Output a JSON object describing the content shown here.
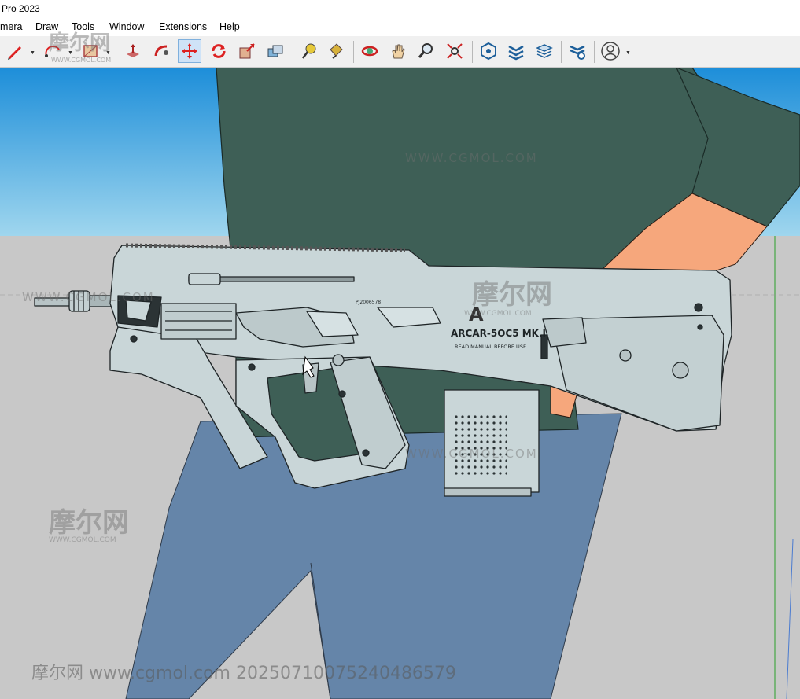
{
  "window": {
    "title": "Pro 2023"
  },
  "menu": {
    "items": [
      "mera",
      "Draw",
      "Tools",
      "Window",
      "Extensions",
      "Help"
    ]
  },
  "toolbar": {
    "tools": [
      {
        "name": "pencil-tool",
        "icon": "pencil-icon"
      },
      {
        "name": "arc-tool",
        "icon": "arc-icon"
      },
      {
        "name": "rectangle-tool",
        "icon": "rectangle-icon"
      },
      {
        "name": "push-pull-tool",
        "icon": "push-pull-icon"
      },
      {
        "name": "follow-me-tool",
        "icon": "follow-me-icon"
      },
      {
        "name": "move-tool",
        "icon": "move-icon"
      },
      {
        "name": "rotate-tool",
        "icon": "rotate-icon"
      },
      {
        "name": "scale-tool",
        "icon": "scale-icon"
      },
      {
        "name": "offset-tool",
        "icon": "offset-icon"
      },
      {
        "name": "tape-measure-tool",
        "icon": "tape-measure-icon"
      },
      {
        "name": "paint-bucket-tool",
        "icon": "paint-bucket-icon"
      },
      {
        "name": "orbit-tool",
        "icon": "orbit-icon"
      },
      {
        "name": "pan-tool",
        "icon": "pan-hand-icon"
      },
      {
        "name": "zoom-tool",
        "icon": "zoom-icon"
      },
      {
        "name": "zoom-extents-tool",
        "icon": "zoom-extents-icon"
      },
      {
        "name": "warehouse-tool",
        "icon": "warehouse-icon"
      },
      {
        "name": "extension-warehouse-tool",
        "icon": "extension-warehouse-icon"
      },
      {
        "name": "layer-stack-tool",
        "icon": "layers-icon"
      },
      {
        "name": "extension-manager-tool",
        "icon": "extension-manager-icon"
      },
      {
        "name": "account-menu",
        "icon": "user-account-icon"
      }
    ],
    "active_tool": "move-tool"
  },
  "model": {
    "receiver_marking": "ARCAR-5OC5 MK.I",
    "warning_text": "READ MANUAL BEFORE USE",
    "serial_text": "PJ2006578"
  },
  "watermarks": {
    "logo_cn": "摩尔网",
    "logo_en": "WWW.CGMOL.COM",
    "footer": "摩尔网 www.cgmol.com 20250710075240486579"
  },
  "colors": {
    "sky": "#3d9fdc",
    "ground": "#c8c8c8",
    "shirt": "#3e5f56",
    "skin": "#f6a77c",
    "jeans": "#6585a9",
    "rifle": "#c9d6d8",
    "active_tool_bg": "#cfe3f7"
  }
}
